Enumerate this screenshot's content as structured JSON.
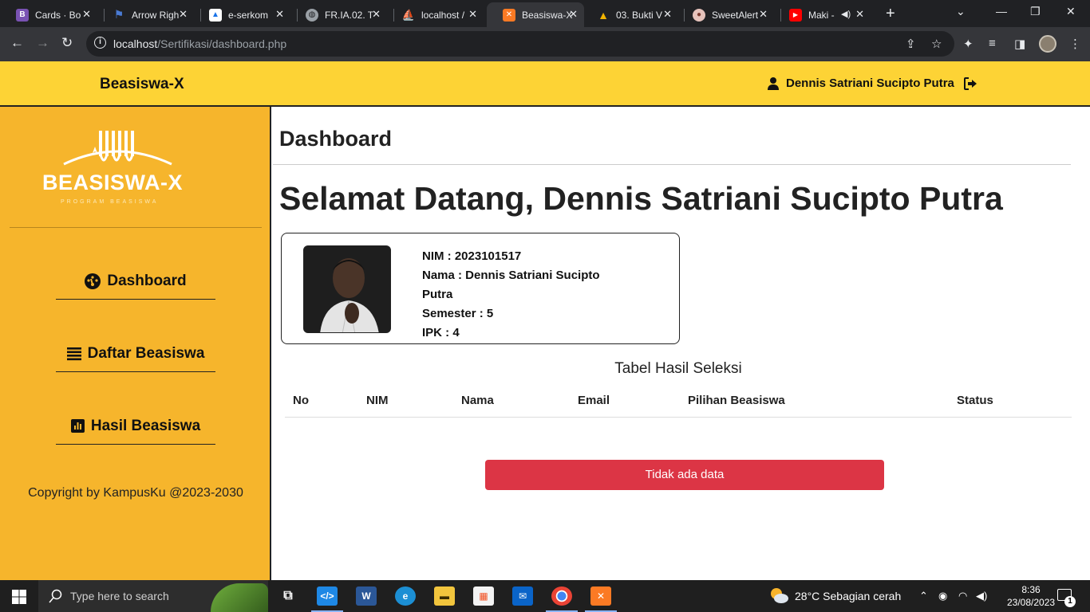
{
  "browser": {
    "tabs": [
      {
        "title": "Cards · Bo",
        "favicon": "bootstrap-icon",
        "color": "#7952b3",
        "glyph": "B"
      },
      {
        "title": "Arrow Righ",
        "favicon": "flag-icon",
        "color": "#4a7bd4",
        "glyph": "⚑"
      },
      {
        "title": "e-serkom",
        "favicon": "drive-icon",
        "color": "#1a73e8",
        "glyph": "▲"
      },
      {
        "title": "FR.IA.02. T",
        "favicon": "globe-icon",
        "color": "#5f6368",
        "glyph": "◍"
      },
      {
        "title": "localhost /",
        "favicon": "phpmyadmin-icon",
        "color": "#c07400",
        "glyph": "⛵"
      },
      {
        "title": "Beasiswa-X",
        "favicon": "xampp-icon",
        "color": "#fb7a24",
        "glyph": "✕"
      },
      {
        "title": "03. Bukti V",
        "favicon": "google-drive-icon",
        "color": "#188038",
        "glyph": "▲"
      },
      {
        "title": "SweetAlert",
        "favicon": "sweetalert-icon",
        "color": "#d7a39a",
        "glyph": "●"
      },
      {
        "title": "Maki - ",
        "favicon": "youtube-icon",
        "color": "#ff0000",
        "glyph": "▶"
      }
    ],
    "active_tab_index": 5,
    "url_host": "localhost",
    "url_path": "/Sertifikasi/dashboard.php"
  },
  "header": {
    "brand": "Beasiswa-X",
    "user_name": "Dennis Satriani Sucipto Putra"
  },
  "sidebar": {
    "logo_text": "BEASISWA-X",
    "logo_subtext": "PROGRAM BEASISWA",
    "items": [
      {
        "label": "Dashboard",
        "icon": "gauge-icon"
      },
      {
        "label": "Daftar Beasiswa",
        "icon": "list-icon"
      },
      {
        "label": "Hasil Beasiswa",
        "icon": "chart-icon"
      }
    ],
    "copyright": "Copyright by KampusKu @2023-2030"
  },
  "main": {
    "page_title": "Dashboard",
    "welcome": "Selamat Datang, Dennis Satriani Sucipto Putra",
    "profile": {
      "nim": "NIM : 2023101517",
      "nama_line1": "Nama : Dennis Satriani Sucipto",
      "nama_line2": "Putra",
      "semester": "Semester : 5",
      "ipk": "IPK : 4"
    },
    "table": {
      "title": "Tabel Hasil Seleksi",
      "columns": [
        "No",
        "NIM",
        "Nama",
        "Email",
        "Pilihan Beasiswa",
        "Status"
      ],
      "empty_message": "Tidak ada data"
    }
  },
  "taskbar": {
    "search_placeholder": "Type here to search",
    "weather": "28°C  Sebagian cerah",
    "time": "8:36",
    "date": "23/08/2023",
    "notification_count": "1"
  },
  "colors": {
    "topbar": "#fdd335",
    "sidebar": "#f6b52c",
    "danger": "#dc3545"
  }
}
